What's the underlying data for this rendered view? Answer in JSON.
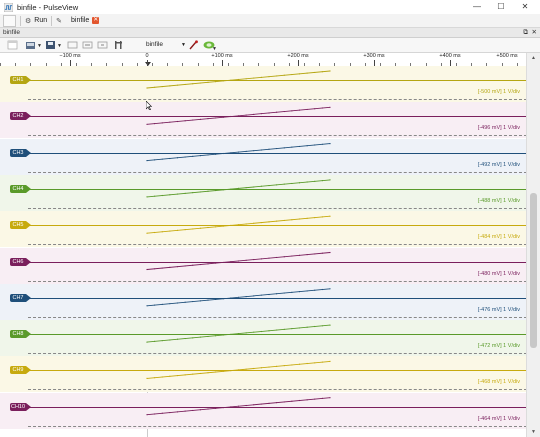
{
  "window": {
    "title": "binfile - PulseView",
    "minimize_glyph": "—",
    "maximize_glyph": "☐",
    "close_glyph": "✕"
  },
  "tabs": {
    "run_label": "Run",
    "file_tab_label": "binfile",
    "file_tab_close": "✕"
  },
  "dock": {
    "title": "binfile",
    "float_glyph": "⧉",
    "close_glyph": "✕"
  },
  "toolbar": {
    "device_name": "binfile",
    "dropdown_glyph": "▼"
  },
  "ruler": {
    "ticks": [
      "−100 ms",
      "0",
      "+100 ms",
      "+200 ms",
      "+300 ms",
      "+400 ms",
      "+500 ms"
    ]
  },
  "channels": [
    {
      "name": "CH1",
      "scale": "[-500 mV] 1 V/div",
      "color": "#b5a612"
    },
    {
      "name": "CH2",
      "scale": "[-496 mV] 1 V/div",
      "color": "#7a1f5c"
    },
    {
      "name": "CH3",
      "scale": "[-492 mV] 1 V/div",
      "color": "#1f4f7a"
    },
    {
      "name": "CH4",
      "scale": "[-488 mV] 1 V/div",
      "color": "#5a9a2a"
    },
    {
      "name": "CH5",
      "scale": "[-484 mV] 1 V/div",
      "color": "#c7aa0e"
    },
    {
      "name": "CH6",
      "scale": "[-480 mV] 1 V/div",
      "color": "#7a1f5c"
    },
    {
      "name": "CH7",
      "scale": "[-476 mV] 1 V/div",
      "color": "#1f4f7a"
    },
    {
      "name": "CH8",
      "scale": "[-472 mV] 1 V/div",
      "color": "#5a9a2a"
    },
    {
      "name": "CH9",
      "scale": "[-468 mV] 1 V/div",
      "color": "#c7aa0e"
    },
    {
      "name": "CH10",
      "scale": "[-464 mV] 1 V/div",
      "color": "#7a1f5c"
    }
  ],
  "colors": {
    "lane_bg_yellow": "#fbf8e6",
    "lane_bg_purple": "#f8eef4",
    "lane_bg_blue": "#eef2f8",
    "lane_bg_green": "#f0f6ea"
  }
}
